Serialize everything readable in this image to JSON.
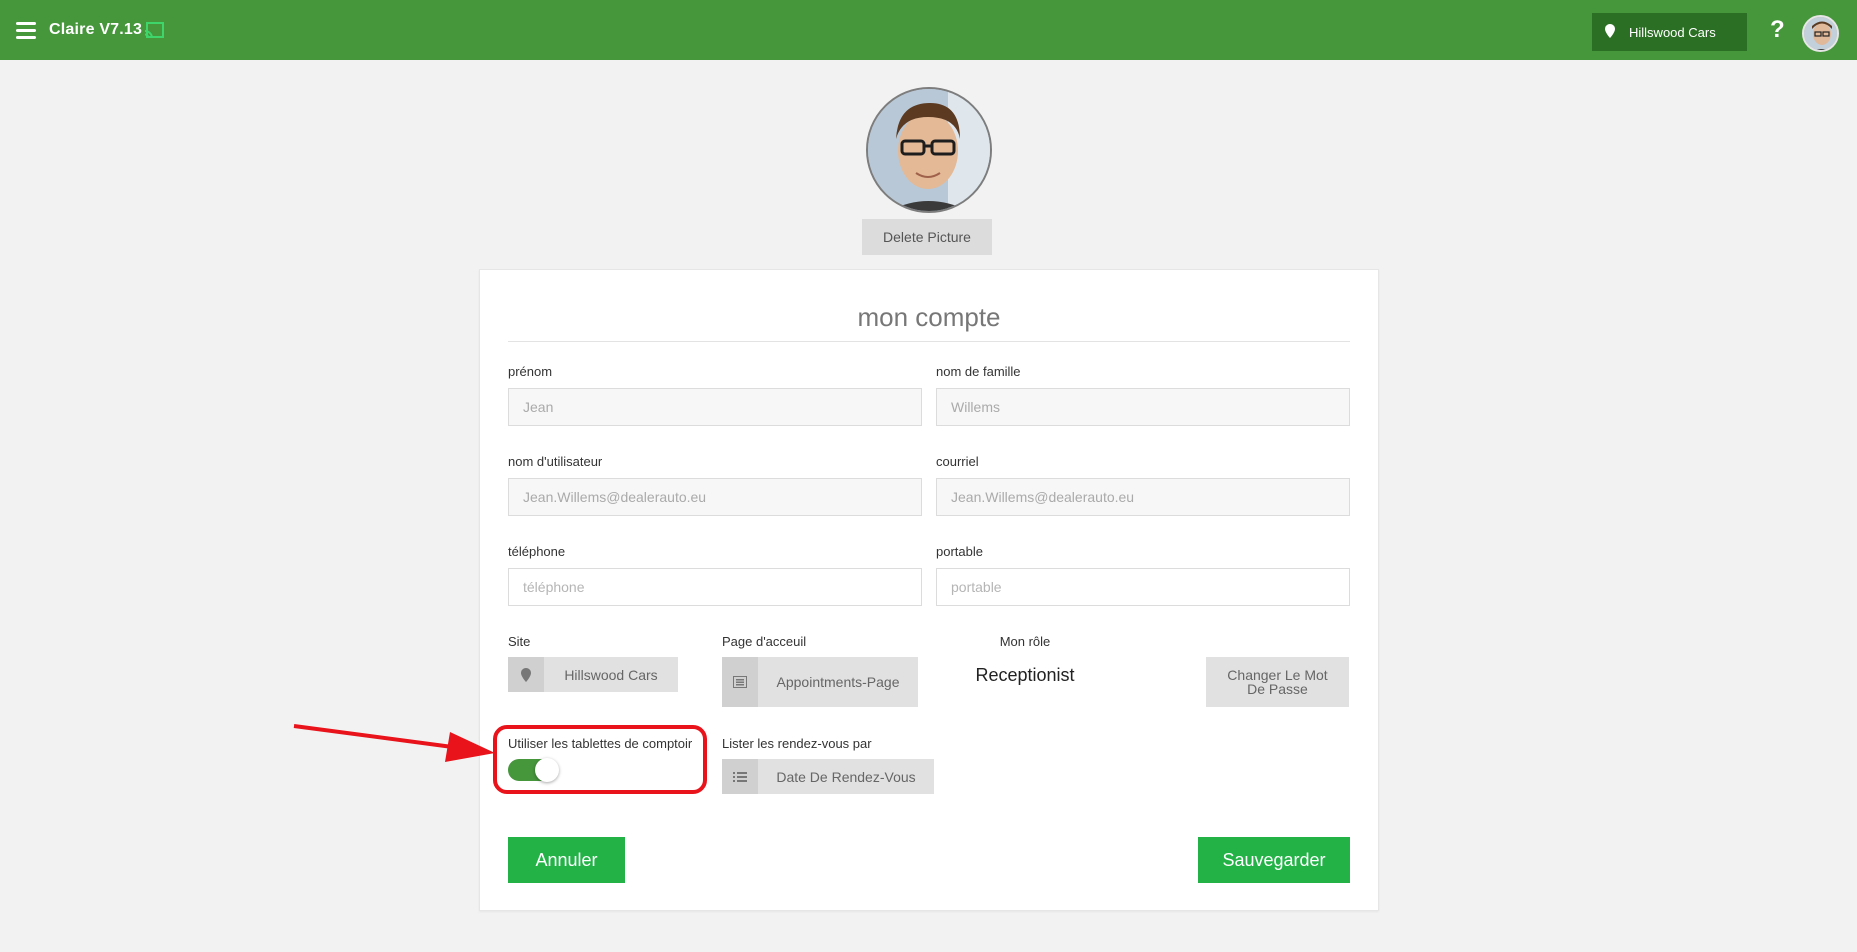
{
  "header": {
    "app_title": "Claire V7.13",
    "site_selector": "Hillswood Cars",
    "help": "?"
  },
  "profile": {
    "delete_picture": "Delete Picture"
  },
  "form": {
    "title": "mon compte",
    "first_name": {
      "label": "prénom",
      "value": "Jean"
    },
    "last_name": {
      "label": "nom de famille",
      "value": "Willems"
    },
    "username": {
      "label": "nom d'utilisateur",
      "value": "Jean.Willems@dealerauto.eu"
    },
    "email": {
      "label": "courriel",
      "value": "Jean.Willems@dealerauto.eu"
    },
    "phone": {
      "label": "téléphone",
      "placeholder": "téléphone"
    },
    "mobile": {
      "label": "portable",
      "placeholder": "portable"
    },
    "site": {
      "label": "Site",
      "value": "Hillswood Cars"
    },
    "home_page": {
      "label": "Page d'acceuil",
      "value": "Appointments-Page"
    },
    "role": {
      "label": "Mon rôle",
      "value": "Receptionist"
    },
    "change_password": "Changer Le Mot De Passe",
    "counter_tablets": {
      "label": "Utiliser les tablettes de comptoir",
      "enabled": true
    },
    "list_appointments": {
      "label": "Lister les rendez-vous par",
      "value": "Date De Rendez-Vous"
    },
    "cancel": "Annuler",
    "save": "Sauvegarder"
  },
  "colors": {
    "topbar": "#46963c",
    "site_selector_bg": "#2b6f24",
    "primary_button": "#22b246",
    "annotation": "#e8131b"
  }
}
